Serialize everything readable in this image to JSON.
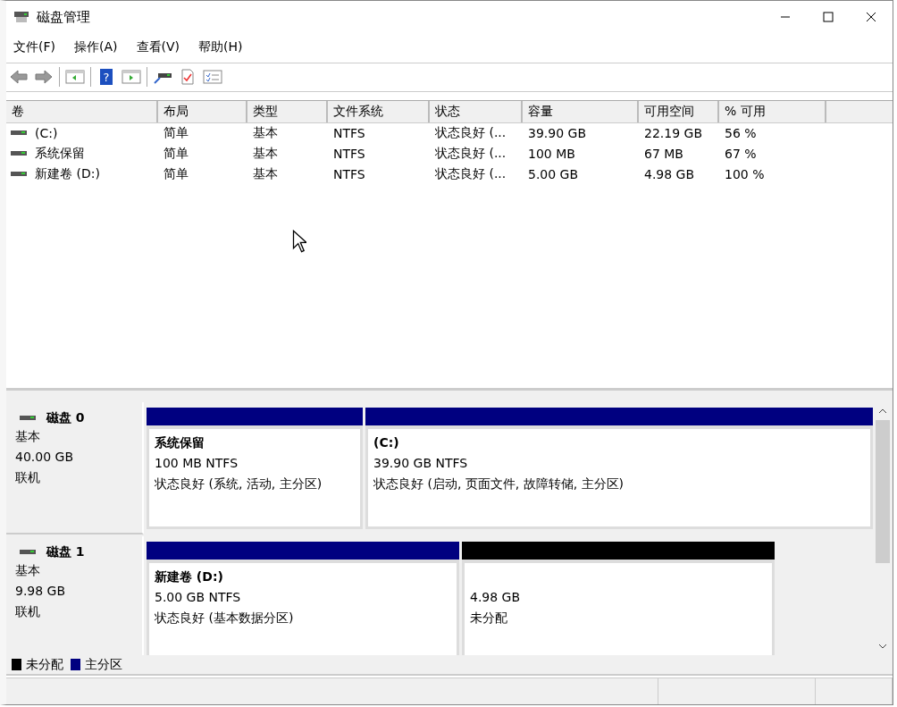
{
  "window": {
    "title": "磁盘管理"
  },
  "menu": [
    "文件(F)",
    "操作(A)",
    "查看(V)",
    "帮助(H)"
  ],
  "toolbar": {
    "help_glyph": "?"
  },
  "table": {
    "columns": [
      "卷",
      "布局",
      "类型",
      "文件系统",
      "状态",
      "容量",
      "可用空间",
      "% 可用"
    ],
    "rows": [
      [
        "(C:)",
        "简单",
        "基本",
        "NTFS",
        "状态良好 (...",
        "39.90 GB",
        "22.19 GB",
        "56 %"
      ],
      [
        "系统保留",
        "简单",
        "基本",
        "NTFS",
        "状态良好 (...",
        "100 MB",
        "67 MB",
        "67 %"
      ],
      [
        "新建卷 (D:)",
        "简单",
        "基本",
        "NTFS",
        "状态良好 (...",
        "5.00 GB",
        "4.98 GB",
        "100 %"
      ]
    ]
  },
  "disks": [
    {
      "name": "磁盘 0",
      "type": "基本",
      "size": "40.00 GB",
      "status": "联机",
      "partitions": [
        {
          "kind": "primary",
          "title": "系统保留",
          "size": "100 MB NTFS",
          "status": "状态良好 (系统, 活动, 主分区)"
        },
        {
          "kind": "primary",
          "title": "(C:)",
          "size": "39.90 GB NTFS",
          "status": "状态良好 (启动, 页面文件, 故障转储, 主分区)"
        }
      ]
    },
    {
      "name": "磁盘 1",
      "type": "基本",
      "size": "9.98 GB",
      "status": "联机",
      "partitions": [
        {
          "kind": "primary",
          "title": "新建卷 (D:)",
          "size": "5.00 GB NTFS",
          "status": "状态良好 (基本数据分区)"
        },
        {
          "kind": "unallocated",
          "size": "4.98 GB",
          "status": "未分配"
        }
      ]
    }
  ],
  "legend": [
    {
      "label": "未分配",
      "color": "#000000"
    },
    {
      "label": "主分区",
      "color": "#000080"
    }
  ]
}
